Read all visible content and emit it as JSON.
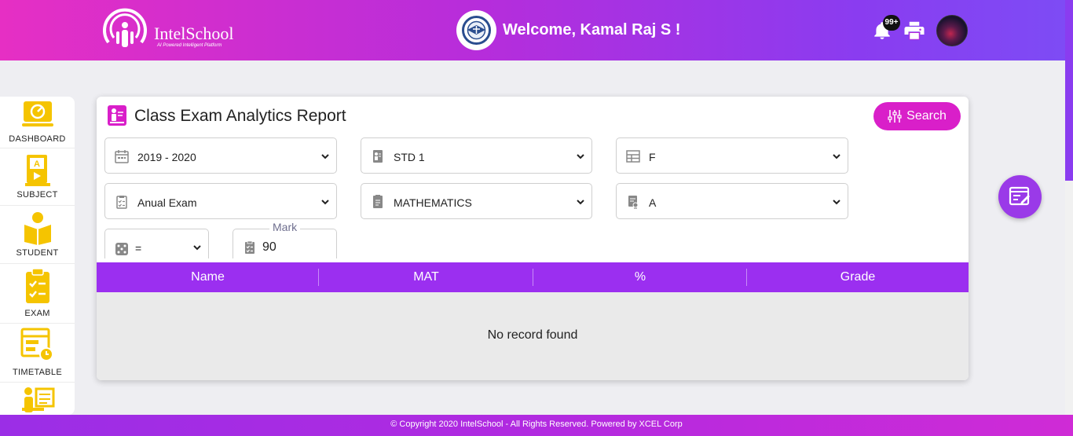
{
  "header": {
    "logo_text": "IntelSchool",
    "logo_tagline": "AI Powered Intelligent Platform",
    "welcome": "Welcome, Kamal Raj S !",
    "notification_count": "99+"
  },
  "sidebar": {
    "items": [
      {
        "label": "DASHBOARD",
        "icon": "dashboard-icon"
      },
      {
        "label": "SUBJECT",
        "icon": "subject-icon"
      },
      {
        "label": "STUDENT",
        "icon": "student-icon"
      },
      {
        "label": "EXAM",
        "icon": "exam-icon"
      },
      {
        "label": "TIMETABLE",
        "icon": "timetable-icon"
      },
      {
        "label": "",
        "icon": "teacher-icon"
      }
    ]
  },
  "report": {
    "title": "Class Exam Analytics Report",
    "search_label": "Search",
    "filters": {
      "year": "2019 - 2020",
      "standard": "STD 1",
      "section": "F",
      "exam": "Anual Exam",
      "subject": "MATHEMATICS",
      "grade": "A",
      "operator": "=",
      "mark_label": "Mark",
      "mark_value": "90"
    },
    "table": {
      "columns": [
        "Name",
        "MAT",
        "%",
        "Grade"
      ],
      "empty_message": "No record found"
    }
  },
  "footer": {
    "copyright": "© Copyright 2020 IntelSchool - All Rights Reserved. Powered by XCEL Corp"
  },
  "colors": {
    "accent_purple": "#9b2ff0",
    "accent_magenta": "#d91fc9",
    "sidebar_icon_yellow": "#f5c400"
  }
}
